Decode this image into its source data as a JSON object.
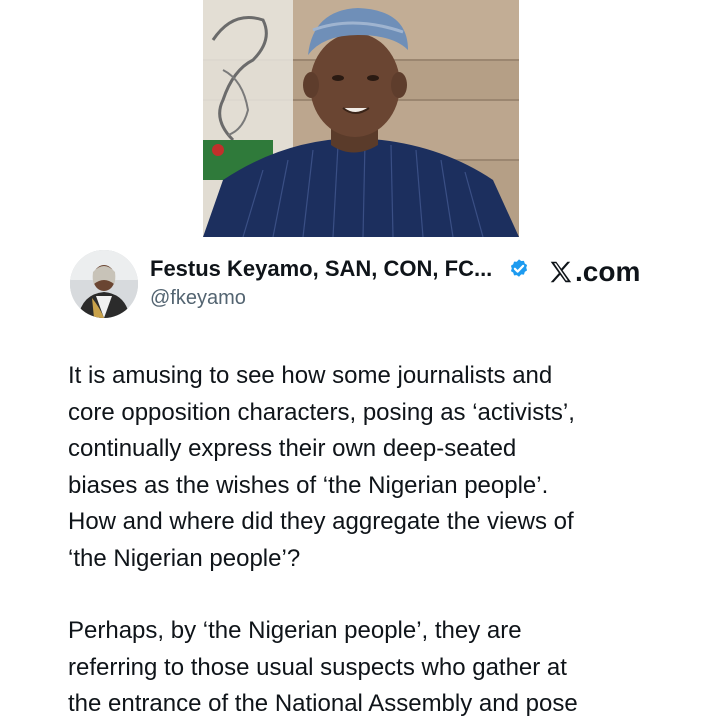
{
  "post": {
    "author": {
      "display_name": "Festus Keyamo, SAN, CON, FC...",
      "handle": "@fkeyamo",
      "verified": true
    },
    "source_label": ".com",
    "source_icon": "x-logo-icon",
    "paragraphs": [
      "It is amusing to see how some journalists  and\ncore opposition characters, posing as ‘activists’,\ncontinually express their own deep-seated\nbiases as the wishes of ‘the Nigerian people’.\nHow and where did they aggregate the views of\n‘the Nigerian people’?",
      "Perhaps, by ‘the Nigerian people’, they are\nreferring to those usual suspects who gather at\nthe entrance of the National Assembly and pose"
    ]
  },
  "colors": {
    "text_primary": "#0f1419",
    "text_secondary": "#536471",
    "verified_blue": "#1d9bf0",
    "agbada_navy": "#1c2f5e",
    "cap_blue": "#6f8fb8"
  }
}
